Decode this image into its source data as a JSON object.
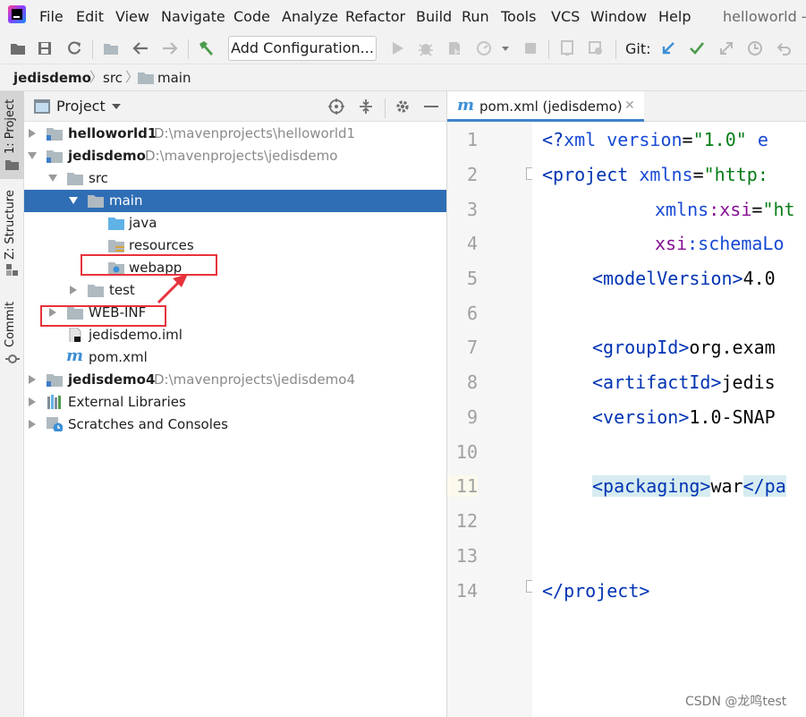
{
  "menu": [
    "File",
    "Edit",
    "View",
    "Navigate",
    "Code",
    "Analyze",
    "Refactor",
    "Build",
    "Run",
    "Tools",
    "VCS",
    "Window",
    "Help"
  ],
  "window_title": "helloworld -",
  "toolbar": {
    "add_configuration": "Add Configuration...",
    "git_label": "Git:"
  },
  "breadcrumb": [
    "jedisdemo",
    "src",
    "main"
  ],
  "left_strip": {
    "project_tab": "1: Project",
    "structure_tab": "Z: Structure",
    "commit_tab": "Commit"
  },
  "project_panel": {
    "title": "Project",
    "tree": [
      {
        "label": "helloworld1",
        "path": "D:\\mavenprojects\\helloworld1"
      },
      {
        "label": "jedisdemo",
        "path": "D:\\mavenprojects\\jedisdemo"
      },
      {
        "label": "src"
      },
      {
        "label": "main"
      },
      {
        "label": "java"
      },
      {
        "label": "resources"
      },
      {
        "label": "webapp"
      },
      {
        "label": "test"
      },
      {
        "label": "WEB-INF"
      },
      {
        "label": "jedisdemo.iml"
      },
      {
        "label": "pom.xml"
      },
      {
        "label": "jedisdemo4",
        "path": "D:\\mavenprojects\\jedisdemo4"
      },
      {
        "label": "External Libraries"
      },
      {
        "label": "Scratches and Consoles"
      }
    ]
  },
  "editor": {
    "tab_label": "pom.xml (jedisdemo)",
    "tab_icon_letter": "m",
    "line_numbers": [
      "1",
      "2",
      "3",
      "4",
      "5",
      "6",
      "7",
      "8",
      "9",
      "10",
      "11",
      "12",
      "13",
      "14"
    ],
    "code": {
      "l1": {
        "a": "<?",
        "b": "xml version",
        "c": "=",
        "d": "\"1.0\"",
        "e": " e"
      },
      "l2": {
        "a": "<project ",
        "b": "xmlns",
        "c": "=",
        "d": "\"http:"
      },
      "l3": {
        "b": "xmlns",
        "p": ":xsi",
        "c": "=",
        "d": "\"ht"
      },
      "l4": {
        "p": "xsi",
        "b": ":schemaLo"
      },
      "l5": {
        "a": "<modelVersion>",
        "t": "4.0"
      },
      "l7": {
        "a": "<groupId>",
        "t": "org.exam"
      },
      "l8": {
        "a": "<artifactId>",
        "t": "jedis"
      },
      "l9": {
        "a": "<version>",
        "t": "1.0-SNAP"
      },
      "l11": {
        "a": "<packaging>",
        "t": "war",
        "c": "</pa"
      },
      "l14": {
        "a": "</project>"
      }
    }
  },
  "watermark": "CSDN @龙鸣test"
}
